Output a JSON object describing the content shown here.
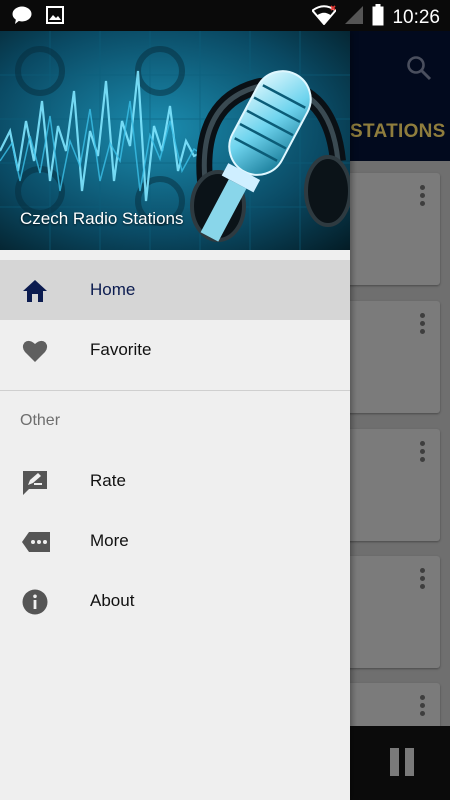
{
  "status_bar": {
    "time": "10:26",
    "left_icons": [
      "chat-bubble-icon",
      "image-icon"
    ],
    "right_icons": [
      "wifi-icon",
      "signal-icon",
      "battery-icon"
    ]
  },
  "drawer": {
    "header_title": "Czech Radio Stations",
    "items": [
      {
        "label": "Home",
        "icon": "home-icon",
        "active": true
      },
      {
        "label": "Favorite",
        "icon": "heart-icon",
        "active": false
      }
    ],
    "section_label": "Other",
    "other_items": [
      {
        "label": "Rate",
        "icon": "rate-icon"
      },
      {
        "label": "More",
        "icon": "more-icon"
      },
      {
        "label": "About",
        "icon": "info-icon"
      }
    ]
  },
  "background_app": {
    "tab_label": "STATIONS",
    "icons": [
      "search-icon",
      "overflow-menu-icon",
      "pause-icon"
    ]
  },
  "colors": {
    "toolbar": "#020a1e",
    "tab_text": "#8f7d3d",
    "active_item_bg": "#d6d6d6",
    "active_item_text": "#0c1c50",
    "icon_gray": "#555555"
  }
}
